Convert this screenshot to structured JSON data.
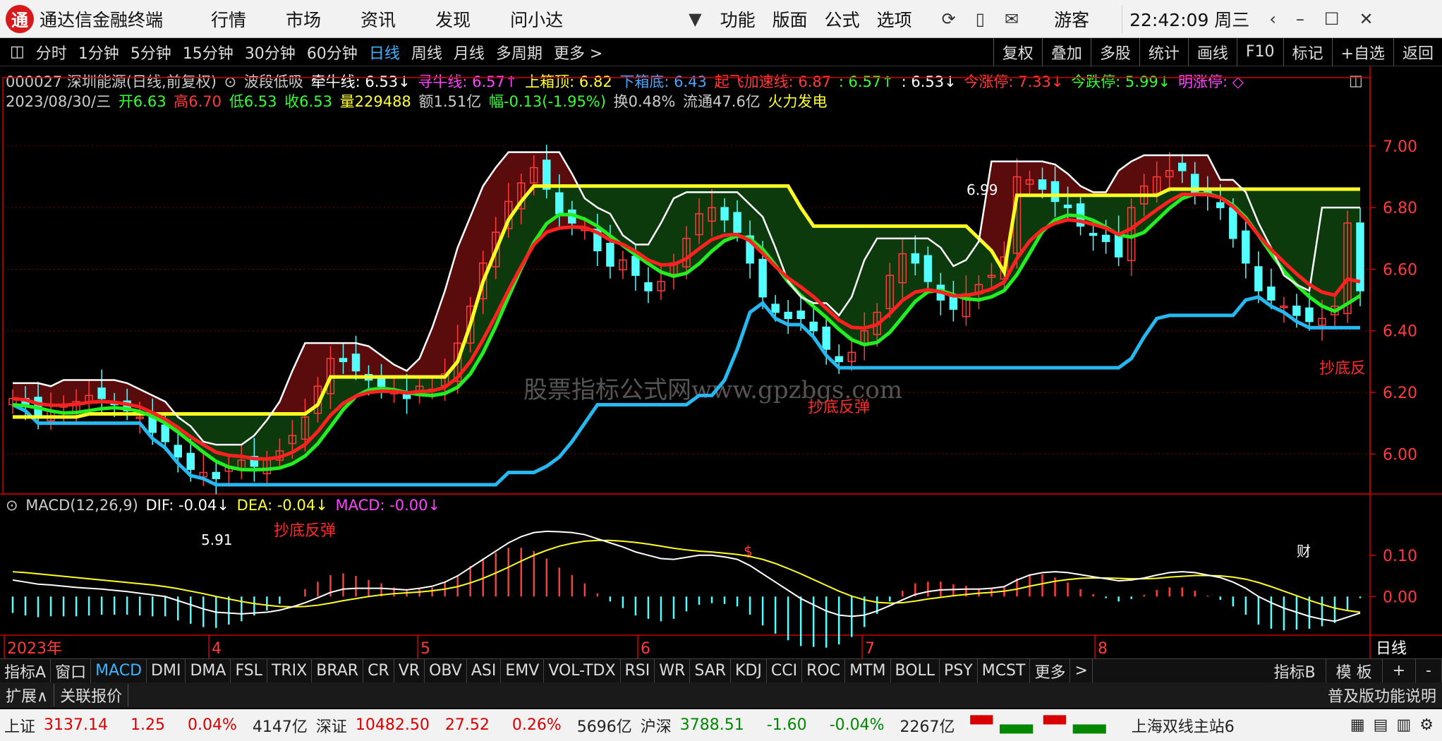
{
  "titlebar": {
    "logo_text": "通",
    "app_name": "通达信金融终端",
    "menus": [
      "行情",
      "市场",
      "资讯",
      "发现",
      "问小达"
    ],
    "right_menus": [
      "功能",
      "版面",
      "公式",
      "选项"
    ],
    "user": "游客",
    "clock": "22:42:09 周三"
  },
  "periodbar": {
    "periods": [
      "分时",
      "1分钟",
      "5分钟",
      "15分钟",
      "30分钟",
      "60分钟",
      "日线",
      "周线",
      "月线",
      "多周期",
      "更多 >"
    ],
    "selected_index": 6,
    "right_buttons": [
      "复权",
      "叠加",
      "多股",
      "统计",
      "画线",
      "F10",
      "标记",
      "+自选",
      "返回"
    ]
  },
  "indicator_line": {
    "stock": "000027 深圳能源(日线,前复权)",
    "formula": "波段低吸",
    "qianniu": "牵牛线: 6.53↓",
    "xunniu": "寻牛线: 6.57↑",
    "upper_box": "上箱顶: 6.82",
    "lower_box": "下箱底: 6.43",
    "takeoff": "起飞加速线: 6.87",
    "takeoff2": ": 6.57↑",
    "v653": ": 6.53↓",
    "limit_up": "今涨停: 7.33↓",
    "limit_down": "今跌停: 5.99↓",
    "tomorrow_up": "明涨停: ◇"
  },
  "quote_line": {
    "date": "2023/08/30/三",
    "open": "开6.63",
    "high": "高6.70",
    "low": "低6.53",
    "close": "收6.53",
    "volume": "量229488",
    "amount": "额1.51亿",
    "change": "幅-0.13(-1.95%)",
    "turnover": "换0.48%",
    "float": "流通47.6亿",
    "sector": "火力发电"
  },
  "chart_data": {
    "type": "candlestick",
    "y_ticks": [
      "7.00",
      "6.80",
      "6.60",
      "6.40",
      "6.20",
      "6.00"
    ],
    "ylim": [
      5.87,
      7.08
    ],
    "high_label": "6.99",
    "low_label": "5.91",
    "signals": [
      "抄底反弹",
      "抄底反弹",
      "抄底反"
    ],
    "markers": [
      "$",
      "财"
    ],
    "watermark": "股票指标公式网www.gpzbgs.com",
    "months": [
      "2023年",
      "4",
      "5",
      "6",
      "7",
      "8"
    ],
    "period_label": "日线",
    "close": [
      6.18,
      6.16,
      6.12,
      6.14,
      6.16,
      6.17,
      6.19,
      6.18,
      6.16,
      6.14,
      6.12,
      6.07,
      6.04,
      5.99,
      5.95,
      5.94,
      5.92,
      5.96,
      5.98,
      5.96,
      5.98,
      6.01,
      6.06,
      6.12,
      6.22,
      6.31,
      6.3,
      6.27,
      6.24,
      6.22,
      6.2,
      6.18,
      6.22,
      6.21,
      6.26,
      6.36,
      6.48,
      6.62,
      6.72,
      6.82,
      6.88,
      6.93,
      6.86,
      6.78,
      6.75,
      6.73,
      6.66,
      6.61,
      6.63,
      6.58,
      6.53,
      6.56,
      6.62,
      6.7,
      6.78,
      6.8,
      6.76,
      6.72,
      6.62,
      6.51,
      6.46,
      6.44,
      6.44,
      6.4,
      6.34,
      6.3,
      6.33,
      6.4,
      6.46,
      6.58,
      6.65,
      6.62,
      6.56,
      6.5,
      6.47,
      6.52,
      6.55,
      6.58,
      6.64,
      6.9,
      6.89,
      6.86,
      6.82,
      6.8,
      6.74,
      6.71,
      6.69,
      6.64,
      6.8,
      6.87,
      6.9,
      6.92,
      6.92,
      6.84,
      6.84,
      6.8,
      6.7,
      6.62,
      6.53,
      6.5,
      6.48,
      6.45,
      6.43,
      6.44,
      6.48,
      6.75,
      6.53
    ]
  },
  "macd": {
    "label": "MACD(12,26,9)",
    "dif": "DIF: -0.04↓",
    "dea": "DEA: -0.04↓",
    "macd": "MACD: -0.00↓",
    "y_ticks": [
      "0.10",
      "0.00"
    ],
    "dif_values": [
      0.04,
      0.035,
      0.03,
      0.028,
      0.025,
      0.022,
      0.02,
      0.018,
      0.015,
      0.012,
      0.008,
      0.004,
      0.0,
      -0.01,
      -0.02,
      -0.03,
      -0.038,
      -0.04,
      -0.042,
      -0.04,
      -0.038,
      -0.033,
      -0.025,
      -0.015,
      -0.003,
      0.01,
      0.018,
      0.02,
      0.02,
      0.02,
      0.018,
      0.016,
      0.02,
      0.025,
      0.035,
      0.05,
      0.07,
      0.09,
      0.11,
      0.13,
      0.145,
      0.155,
      0.158,
      0.157,
      0.155,
      0.15,
      0.14,
      0.13,
      0.12,
      0.108,
      0.1,
      0.092,
      0.09,
      0.095,
      0.1,
      0.1,
      0.096,
      0.09,
      0.075,
      0.055,
      0.035,
      0.015,
      -0.005,
      -0.02,
      -0.035,
      -0.045,
      -0.048,
      -0.045,
      -0.035,
      -0.022,
      -0.008,
      0.005,
      0.012,
      0.016,
      0.017,
      0.018,
      0.018,
      0.02,
      0.024,
      0.04,
      0.052,
      0.058,
      0.06,
      0.058,
      0.053,
      0.048,
      0.043,
      0.038,
      0.04,
      0.045,
      0.052,
      0.058,
      0.06,
      0.058,
      0.052,
      0.046,
      0.035,
      0.02,
      0.0,
      -0.015,
      -0.028,
      -0.038,
      -0.048,
      -0.055,
      -0.06,
      -0.05,
      -0.04
    ],
    "dea_values": [
      0.06,
      0.058,
      0.055,
      0.052,
      0.049,
      0.046,
      0.043,
      0.04,
      0.037,
      0.034,
      0.031,
      0.028,
      0.024,
      0.019,
      0.013,
      0.007,
      0.0,
      -0.006,
      -0.012,
      -0.017,
      -0.021,
      -0.024,
      -0.025,
      -0.024,
      -0.021,
      -0.016,
      -0.01,
      -0.005,
      -0.0,
      0.004,
      0.007,
      0.009,
      0.011,
      0.014,
      0.018,
      0.024,
      0.033,
      0.044,
      0.057,
      0.071,
      0.086,
      0.1,
      0.112,
      0.122,
      0.129,
      0.134,
      0.136,
      0.136,
      0.134,
      0.131,
      0.127,
      0.122,
      0.117,
      0.113,
      0.11,
      0.108,
      0.105,
      0.102,
      0.097,
      0.09,
      0.08,
      0.068,
      0.055,
      0.041,
      0.027,
      0.013,
      0.001,
      -0.008,
      -0.014,
      -0.016,
      -0.015,
      -0.011,
      -0.006,
      -0.002,
      0.002,
      0.005,
      0.008,
      0.01,
      0.013,
      0.018,
      0.025,
      0.031,
      0.037,
      0.041,
      0.044,
      0.045,
      0.045,
      0.044,
      0.043,
      0.043,
      0.044,
      0.047,
      0.049,
      0.051,
      0.051,
      0.05,
      0.047,
      0.042,
      0.034,
      0.024,
      0.013,
      0.002,
      -0.009,
      -0.019,
      -0.028,
      -0.034,
      -0.038
    ]
  },
  "tabs": [
    "指标A",
    "窗口",
    "MACD",
    "DMI",
    "DMA",
    "FSL",
    "TRIX",
    "BRAR",
    "CR",
    "VR",
    "OBV",
    "ASI",
    "EMV",
    "VOL-TDX",
    "RSI",
    "WR",
    "SAR",
    "KDJ",
    "CCI",
    "ROC",
    "MTM",
    "BOLL",
    "PSY",
    "MCST",
    "更多",
    ">"
  ],
  "tabs_selected": 2,
  "tabs_right": [
    "指标B",
    "模 板",
    "+",
    "-"
  ],
  "extbar": {
    "expand": "扩展∧",
    "related": "关联报价",
    "edition": "普及版功能说明"
  },
  "statusbar": {
    "sh_name": "上证",
    "sh_val": "3137.14",
    "sh_chg": "1.25",
    "sh_pct": "0.04%",
    "sh_amt": "4147亿",
    "sz_name": "深证",
    "sz_val": "10482.50",
    "sz_chg": "27.52",
    "sz_pct": "0.26%",
    "sz_amt": "5696亿",
    "hs_name": "沪深",
    "hs_val": "3788.51",
    "hs_chg": "-1.60",
    "hs_pct": "-0.04%",
    "hs_amt": "2267亿",
    "server": "上海双线主站6"
  }
}
